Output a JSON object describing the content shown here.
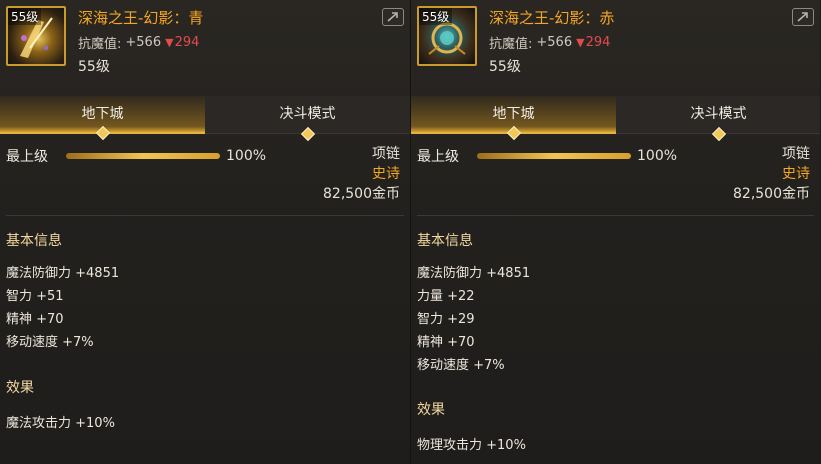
{
  "cards": [
    {
      "level_tag": "55级",
      "name": "深海之王-幻影：青",
      "resist_label": "抗魔值:",
      "resist_plus": "+566",
      "resist_minus": "294",
      "level_text": "55级",
      "tabs": [
        {
          "label": "地下城",
          "active": true
        },
        {
          "label": "决斗模式",
          "active": false
        }
      ],
      "grade_label": "最上级",
      "grade_progress": 100,
      "grade_pct_text": "100%",
      "slot": "项链",
      "rarity": "史诗",
      "price": "82,500金币",
      "basic_title": "基本信息",
      "attributes": [
        "魔法防御力 +4851",
        "智力 +51",
        "精神 +70",
        "移动速度 +7%"
      ],
      "effect_title": "效果",
      "effect": "魔法攻击力 +10%",
      "icon": "ice-necklace-icon"
    },
    {
      "level_tag": "55级",
      "name": "深海之王-幻影：赤",
      "resist_label": "抗魔值:",
      "resist_plus": "+566",
      "resist_minus": "294",
      "level_text": "55级",
      "tabs": [
        {
          "label": "地下城",
          "active": true
        },
        {
          "label": "决斗模式",
          "active": false
        }
      ],
      "grade_label": "最上级",
      "grade_progress": 100,
      "grade_pct_text": "100%",
      "slot": "项链",
      "rarity": "史诗",
      "price": "82,500金币",
      "basic_title": "基本信息",
      "attributes": [
        "魔法防御力 +4851",
        "力量 +22",
        "智力 +29",
        "精神 +70",
        "移动速度 +7%"
      ],
      "effect_title": "效果",
      "effect": "物理攻击力 +10%",
      "icon": "fire-necklace-icon"
    }
  ],
  "colors": {
    "item_name": "#f5a623",
    "rarity_epic": "#f5a623",
    "decrease": "#e34b4b",
    "tab_active": "#e2b43e"
  }
}
